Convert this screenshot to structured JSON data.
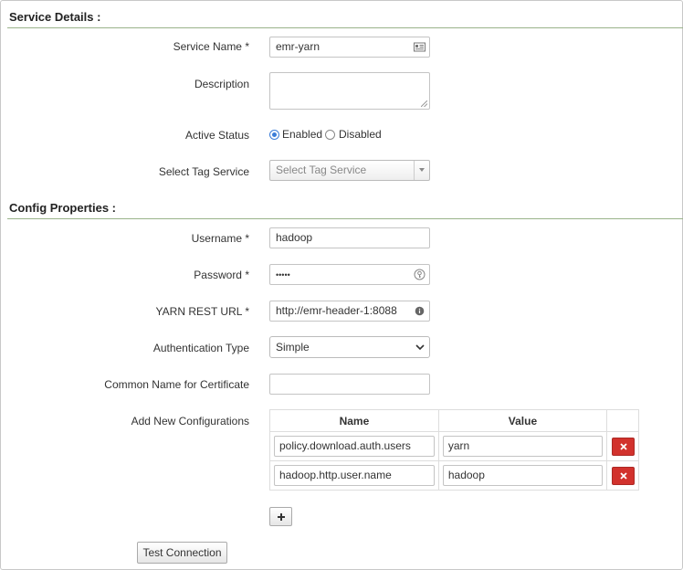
{
  "service_details": {
    "title": "Service Details :",
    "service_name": {
      "label": "Service Name *",
      "value": "emr-yarn",
      "icon": "contact-card-icon"
    },
    "description": {
      "label": "Description",
      "value": ""
    },
    "active_status": {
      "label": "Active Status",
      "options": [
        "Enabled",
        "Disabled"
      ],
      "selected": "Enabled"
    },
    "tag_service": {
      "label": "Select Tag Service",
      "placeholder": "Select Tag Service"
    }
  },
  "config_properties": {
    "title": "Config Properties :",
    "username": {
      "label": "Username *",
      "value": "hadoop"
    },
    "password": {
      "label": "Password *",
      "value": "•••••",
      "icon": "key-icon"
    },
    "yarn_rest_url": {
      "label": "YARN REST URL *",
      "value": "http://emr-header-1:8088",
      "icon": "info-icon"
    },
    "auth_type": {
      "label": "Authentication Type",
      "value": "Simple"
    },
    "common_name": {
      "label": "Common Name for Certificate",
      "value": ""
    },
    "new_configs": {
      "label": "Add New Configurations",
      "columns": [
        "Name",
        "Value"
      ],
      "rows": [
        {
          "name": "policy.download.auth.users",
          "value": "yarn"
        },
        {
          "name": "hadoop.http.user.name",
          "value": "hadoop"
        }
      ]
    }
  },
  "actions": {
    "test_connection": "Test Connection"
  },
  "colors": {
    "section_rule": "#9ab38a",
    "delete_button": "#d2322d",
    "radio_accent": "#3b7dd8"
  }
}
